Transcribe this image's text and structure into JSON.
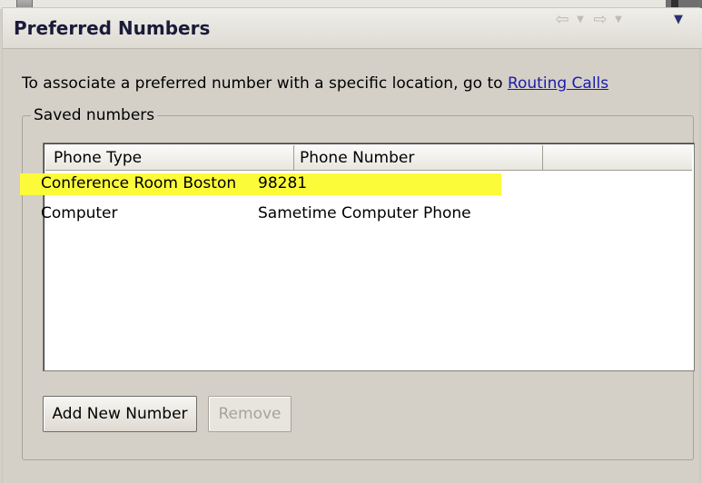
{
  "panel": {
    "title": "Preferred Numbers",
    "nav_icons": [
      "back-arrow-icon",
      "dropdown-icon",
      "forward-arrow-icon",
      "dropdown-icon",
      "view-menu-icon"
    ]
  },
  "info": {
    "text": "To associate a preferred number with a specific location, go to ",
    "link": "Routing Calls"
  },
  "saved_numbers": {
    "legend": "Saved numbers",
    "columns": [
      "Phone Type",
      "Phone Number",
      ""
    ],
    "rows": [
      {
        "type": "Conference Room Boston",
        "number": "98281",
        "highlighted": true
      },
      {
        "type": "Computer",
        "number": "Sametime Computer Phone",
        "highlighted": false
      }
    ],
    "highlight_color": "#fbfb3a"
  },
  "buttons": {
    "add": "Add New Number",
    "remove": "Remove",
    "remove_enabled": false
  }
}
